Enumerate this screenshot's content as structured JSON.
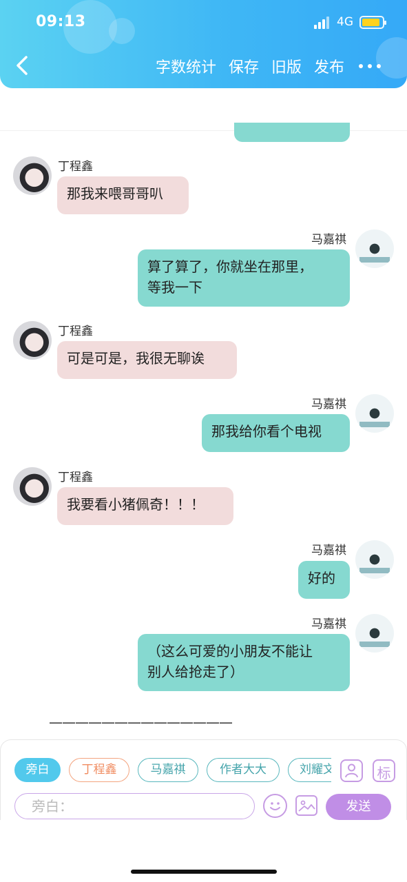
{
  "status_bar": {
    "time": "09:13",
    "network": "4G"
  },
  "toolbar": {
    "items": [
      "字数统计",
      "保存",
      "旧版",
      "发布"
    ]
  },
  "colors": {
    "header_start": "#5bd2f2",
    "header_end": "#35a9f7",
    "left_bubble": "#f2dcdc",
    "right_bubble": "#86d9d0",
    "accent_purple": "#c08ee6",
    "active_chip": "#52c9ec"
  },
  "messages": [
    {
      "side": "left",
      "sender": "丁程鑫",
      "lines": [
        "那我来喂哥哥叭"
      ]
    },
    {
      "side": "right",
      "sender": "马嘉祺",
      "lines": [
        "算了算了，你就坐在那里，",
        "等我一下"
      ]
    },
    {
      "side": "left",
      "sender": "丁程鑫",
      "lines": [
        "可是可是，我很无聊诶"
      ]
    },
    {
      "side": "right",
      "sender": "马嘉祺",
      "lines": [
        "那我给你看个电视"
      ]
    },
    {
      "side": "left",
      "sender": "丁程鑫",
      "lines": [
        "我要看小猪佩奇！！！"
      ]
    },
    {
      "side": "right",
      "sender": "马嘉祺",
      "lines": [
        "好的"
      ]
    },
    {
      "side": "right",
      "sender": "马嘉祺",
      "lines": [
        "（这么可爱的小朋友不能让",
        "别人给抢走了）"
      ]
    }
  ],
  "separator": "——————————————",
  "roles": [
    "旁白",
    "丁程鑫",
    "马嘉祺",
    "作者大大",
    "刘耀文"
  ],
  "role_icons": {
    "character_icon": "user-card-icon",
    "tag_label": "标"
  },
  "input": {
    "placeholder": "旁白："
  },
  "send_label": "发送"
}
